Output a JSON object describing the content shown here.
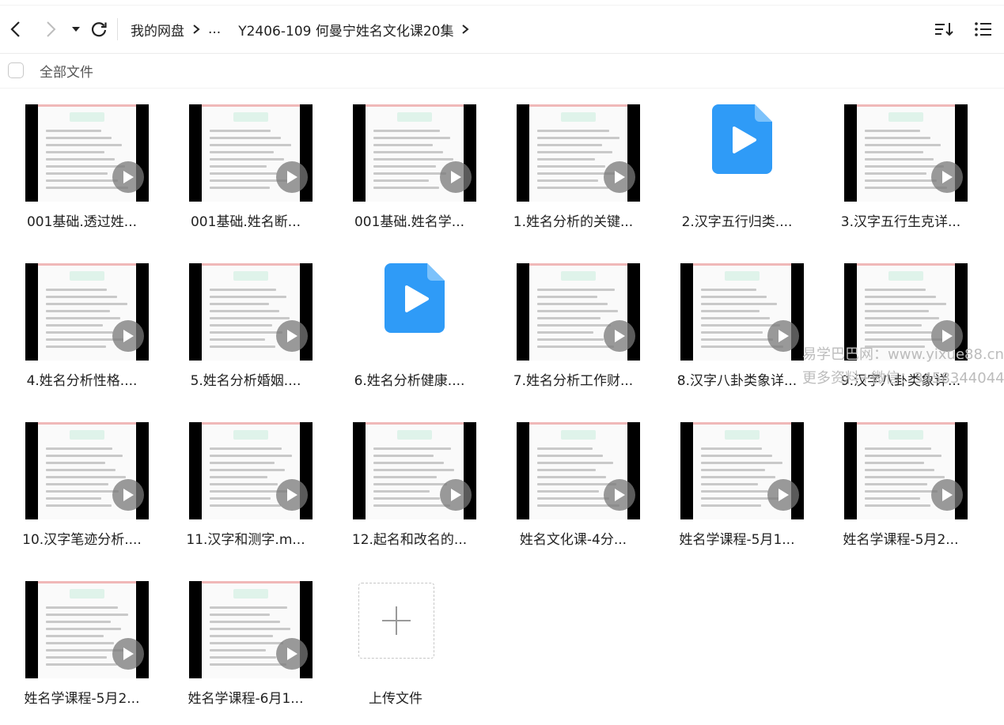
{
  "toolbar": {
    "breadcrumb": [
      "我的网盘",
      "...",
      "Y2406-109 何曼宁姓名文化课20集"
    ]
  },
  "select_all": {
    "label": "全部文件"
  },
  "files": [
    {
      "name": "001基础.透过姓...",
      "kind": "video"
    },
    {
      "name": "001基础.姓名断...",
      "kind": "video"
    },
    {
      "name": "001基础.姓名学...",
      "kind": "video"
    },
    {
      "name": "1.姓名分析的关键...",
      "kind": "video"
    },
    {
      "name": "2.汉字五行归类....",
      "kind": "video-icon"
    },
    {
      "name": "3.汉字五行生克详...",
      "kind": "video"
    },
    {
      "name": "4.姓名分析性格....",
      "kind": "video"
    },
    {
      "name": "5.姓名分析婚姻....",
      "kind": "video"
    },
    {
      "name": "6.姓名分析健康....",
      "kind": "video-icon"
    },
    {
      "name": "7.姓名分析工作财...",
      "kind": "video"
    },
    {
      "name": "8.汉字八卦类象详...",
      "kind": "video"
    },
    {
      "name": "9.汉字八卦类象详...",
      "kind": "video"
    },
    {
      "name": "10.汉字笔迹分析....",
      "kind": "video"
    },
    {
      "name": "11.汉字和测字.m...",
      "kind": "video"
    },
    {
      "name": "12.起名和改名的...",
      "kind": "video"
    },
    {
      "name": "姓名文化课-4分...",
      "kind": "video"
    },
    {
      "name": "姓名学课程-5月1...",
      "kind": "video"
    },
    {
      "name": "姓名学课程-5月2...",
      "kind": "video"
    },
    {
      "name": "姓名学课程-5月2...",
      "kind": "video"
    },
    {
      "name": "姓名学课程-6月1...",
      "kind": "video"
    }
  ],
  "upload": {
    "label": "上传文件"
  },
  "watermark": [
    "易学巴巴网：www.yixue88.cn",
    "更多资料+微信：3458344044"
  ],
  "colors": {
    "accent_blue": "#2f9bf7",
    "play_overlay": "#7a7a7a"
  }
}
